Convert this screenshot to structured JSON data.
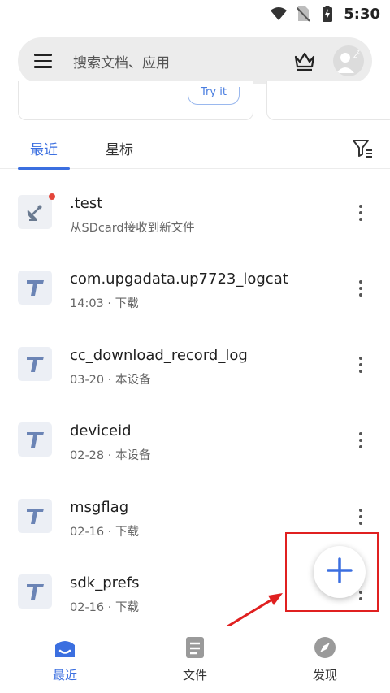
{
  "status_bar": {
    "time": "5:30"
  },
  "search": {
    "placeholder": "搜索文档、应用"
  },
  "card": {
    "try_label": "Try it"
  },
  "tabs": [
    {
      "label": "最近"
    },
    {
      "label": "星标"
    }
  ],
  "files": [
    {
      "name": ".test",
      "meta": "从SDcard接收到新文件",
      "icon": "satellite-icon",
      "unread": true
    },
    {
      "name": "com.upgadata.up7723_logcat",
      "meta": "14:03 · 下载",
      "icon": "text-file-icon"
    },
    {
      "name": "cc_download_record_log",
      "meta": "03-20 · 本设备",
      "icon": "text-file-icon"
    },
    {
      "name": "deviceid",
      "meta": "02-28 · 本设备",
      "icon": "text-file-icon"
    },
    {
      "name": "msgflag",
      "meta": "02-16 · 下载",
      "icon": "text-file-icon"
    },
    {
      "name": "sdk_prefs",
      "meta": "02-16 · 下载",
      "icon": "text-file-icon"
    }
  ],
  "nav": [
    {
      "label": "最近"
    },
    {
      "label": "文件"
    },
    {
      "label": "发现"
    }
  ],
  "colors": {
    "accent": "#3b6fe0",
    "highlight": "#e02020",
    "unread_dot": "#e4453a"
  }
}
